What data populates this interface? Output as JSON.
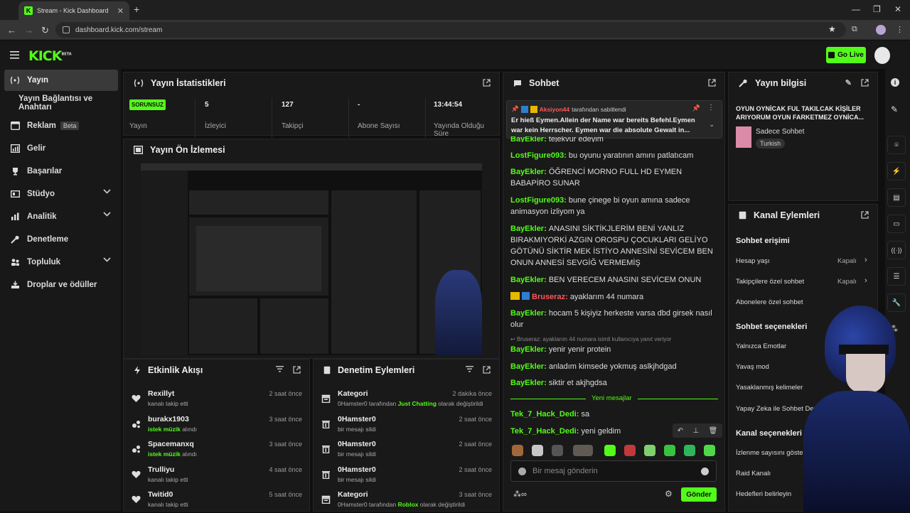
{
  "browser": {
    "tab_title": "Stream - Kick Dashboard",
    "url": "dashboard.kick.com/stream"
  },
  "header": {
    "logo": "KICK",
    "logo_badge": "BETA",
    "go_live": "Go Live"
  },
  "sidebar": {
    "items": [
      {
        "label": "Yayın"
      },
      {
        "label": "Yayın Bağlantısı ve Anahtarı"
      },
      {
        "label": "Reklam",
        "badge": "Beta"
      },
      {
        "label": "Gelir"
      },
      {
        "label": "Başarılar"
      },
      {
        "label": "Stüdyo"
      },
      {
        "label": "Analitik"
      },
      {
        "label": "Denetleme"
      },
      {
        "label": "Topluluk"
      },
      {
        "label": "Droplar ve ödüller"
      }
    ]
  },
  "stats": {
    "title": "Yayın İstatistikleri",
    "status_badge": "SORUNSUZ",
    "items": [
      {
        "value": "",
        "label": "Yayın"
      },
      {
        "value": "5",
        "label": "İzleyici"
      },
      {
        "value": "127",
        "label": "Takipçi"
      },
      {
        "value": "-",
        "label": "Abone Sayısı"
      },
      {
        "value": "13:44:54",
        "label": "Yayında Olduğu Süre"
      }
    ]
  },
  "preview": {
    "title": "Yayın Ön İzlemesi"
  },
  "activity": {
    "title": "Etkinlik Akışı",
    "rows": [
      {
        "name": "Rexillyt",
        "sub": "kanalı takip etti",
        "highlight": "",
        "time": "2 saat önce",
        "icon": "heart-icon"
      },
      {
        "name": "burakx1903",
        "sub": "alındı",
        "highlight": "istek müzik",
        "time": "3 saat önce",
        "icon": "points-icon"
      },
      {
        "name": "Spacemanxq",
        "sub": "alındı",
        "highlight": "istek müzik",
        "time": "3 saat önce",
        "icon": "points-icon"
      },
      {
        "name": "Trulliyu",
        "sub": "kanalı takip etti",
        "highlight": "",
        "time": "4 saat önce",
        "icon": "heart-icon"
      },
      {
        "name": "Twitid0",
        "sub": "kanalı takip etti",
        "highlight": "",
        "time": "5 saat önce",
        "icon": "heart-icon"
      }
    ]
  },
  "moderation": {
    "title": "Denetim Eylemleri",
    "rows": [
      {
        "name": "Kategori",
        "pre": "0Hamster0 tarafından ",
        "highlight": "Just Chatting",
        "post": " olarak değiştirildi",
        "time": "2 dakika önce",
        "icon": "category-icon"
      },
      {
        "name": "0Hamster0",
        "pre": "bir mesajı sildi",
        "highlight": "",
        "post": "",
        "time": "2 saat önce",
        "icon": "trash-icon"
      },
      {
        "name": "0Hamster0",
        "pre": "bir mesajı sildi",
        "highlight": "",
        "post": "",
        "time": "2 saat önce",
        "icon": "trash-icon"
      },
      {
        "name": "0Hamster0",
        "pre": "bir mesajı sildi",
        "highlight": "",
        "post": "",
        "time": "2 saat önce",
        "icon": "trash-icon"
      },
      {
        "name": "Kategori",
        "pre": "0Hamster0 tarafından ",
        "highlight": "Roblox",
        "post": " olarak değiştirildi",
        "time": "3 saat önce",
        "icon": "category-icon"
      }
    ]
  },
  "chat": {
    "title": "Sohbet",
    "pinned_by": "Aksiyon44",
    "pinned_suffix": "tarafından sabitlendi",
    "pinned_text": "Er hieß Eymen.Allein der Name war bereits Befehl.Eymen war kein Herrscher. Eymen war die absolute Gewalt in...",
    "messages": [
      {
        "user": "BayEkler",
        "text": "tejekvur edeyim"
      },
      {
        "user": "LostFigure093",
        "text": "bu oyunu yaratının amını patlatıcam"
      },
      {
        "user": "BayEkler",
        "text": "ÖĞRENCİ MORNO FULL HD EYMEN BABAPİRO SUNAR"
      },
      {
        "user": "LostFigure093",
        "text": "bune çinege bi oyun amına sadece animasyon izliyom ya"
      },
      {
        "user": "BayEkler",
        "text": "ANASINI SİKTİKJLERİM BENİ YANLIZ BIRAKMIYORKİ AZGIN OROSPU ÇOCUKLARI GELİYO GÖTÜNÜ SİKTİR MEK İSTİYO ANNESİNİ SEVİCEM BEN ONUN ANNESİ SEVGİĞ VERMEMİŞ"
      },
      {
        "user": "BayEkler",
        "text": "BEN VERECEM ANASINI SEVİCEM ONUN"
      },
      {
        "user": "Bruseraz",
        "text": "ayaklarım 44 numara"
      },
      {
        "user": "BayEkler",
        "text": "hocam 5 kişiyiz herkeste varsa dbd girsek nasıl olur"
      },
      {
        "user": "BayEkler",
        "text": "yenir yenir protein"
      },
      {
        "user": "BayEkler",
        "text": "anladım kimsede yokmuş aslkjhdgad"
      },
      {
        "user": "BayEkler",
        "text": "siktir et akjhgdsa"
      },
      {
        "user": "Tek_7_Hack_Dedi",
        "text": "sa"
      },
      {
        "user": "Tek_7_Hack_Dedi",
        "text": "yeni geldim"
      }
    ],
    "reply_note": "Bruseraz: ayaklarım 44 numara isimli kullanıcıya yanıt veriyor",
    "new_messages": "Yeni mesajlar",
    "input_placeholder": "Bir mesaj gönderin",
    "send": "Gönder"
  },
  "stream_info": {
    "title": "Yayın bilgisi",
    "stream_title": "OYUN OYNİCAK FUL TAKILCAK KİŞİLER ARIYORUM OYUN FARKETMEZ OYNİCA...",
    "category": "Sadece Sohbet",
    "language": "Turkish"
  },
  "channel_actions": {
    "title": "Kanal Eylemleri",
    "chat_access": "Sohbet erişimi",
    "account_age": "Hesap yaşı",
    "followers_only": "Takipçilere özel sohbet",
    "subscribers_only": "Abonelere özel sohbet",
    "off": "Kapalı",
    "chat_options": "Sohbet seçenekleri",
    "emotes_only": "Yalnızca Emotlar",
    "slow_mode": "Yavaş mod",
    "banned_words": "Yasaklanmış kelimeler",
    "ai_mod": "Yapay Zeka ile Sohbet Denetimi",
    "channel_options": "Kanal seçenekleri",
    "viewer_count": "İzlenme sayısını göster",
    "raid": "Raid Kanalı",
    "goals": "Hedefleri belirleyin"
  },
  "colors": {
    "accent": "#53fc18",
    "panel": "#191919",
    "bg": "#0f0f0f"
  }
}
